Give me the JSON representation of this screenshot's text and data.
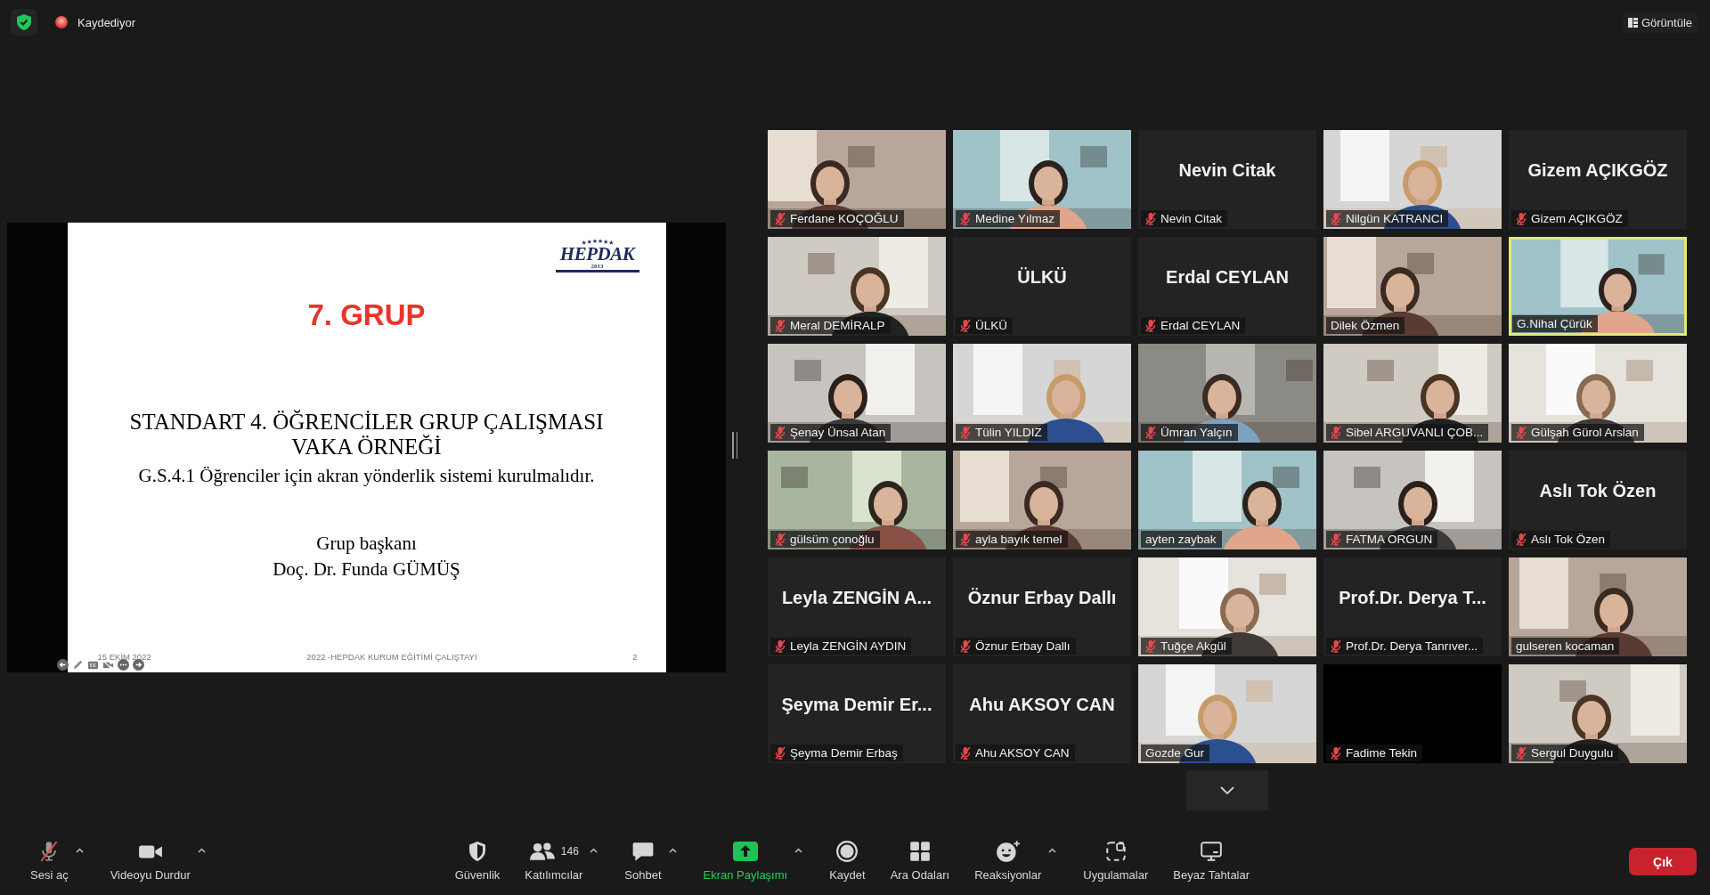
{
  "top_bar": {
    "recording_label": "Kaydediyor",
    "view_button": "Görüntüle"
  },
  "presentation": {
    "logo_text": "HEPDAK",
    "logo_year": "2013",
    "title": "7. GRUP",
    "heading_lines": [
      "STANDART 4. ÖĞRENCİLER GRUP ÇALIŞMASI",
      "VAKA ÖRNEĞİ"
    ],
    "subtitle": "G.S.4.1 Öğrenciler için akran yönderlik sistemi kurulmalıdır.",
    "role": "Grup başkanı",
    "presenter": "Doç. Dr. Funda GÜMÜŞ",
    "footer_date": "15 EKİM 2022",
    "footer_event": "2022 -HEPDAK KURUM EĞİTİMİ ÇALIŞTAYI",
    "page_number": "2"
  },
  "participants": [
    {
      "kind": "video",
      "name": "Ferdane KOÇOĞLU",
      "muted": true,
      "speaking": false
    },
    {
      "kind": "video",
      "name": "Medine Yılmaz",
      "muted": true,
      "speaking": false
    },
    {
      "kind": "name",
      "display_name": "Nevin Citak",
      "name": "Nevin Citak",
      "muted": true,
      "speaking": false
    },
    {
      "kind": "video",
      "name": "Nilgün KATRANCI",
      "muted": true,
      "speaking": false
    },
    {
      "kind": "name",
      "display_name": "Gizem AÇIKGÖZ",
      "name": "Gizem AÇIKGÖZ",
      "muted": true,
      "speaking": false
    },
    {
      "kind": "video",
      "name": "Meral DEMİRALP",
      "muted": true,
      "speaking": false
    },
    {
      "kind": "name",
      "display_name": "ÜLKÜ",
      "name": "ÜLKÜ",
      "muted": true,
      "speaking": false
    },
    {
      "kind": "name",
      "display_name": "Erdal CEYLAN",
      "name": "Erdal CEYLAN",
      "muted": true,
      "speaking": false
    },
    {
      "kind": "video",
      "name": "Dilek Özmen",
      "muted": false,
      "speaking": false
    },
    {
      "kind": "video",
      "name": "G.Nihal Çürük",
      "muted": false,
      "speaking": true
    },
    {
      "kind": "video",
      "name": "Şenay Ünsal Atan",
      "muted": true,
      "speaking": false
    },
    {
      "kind": "video",
      "name": "Tülin YILDIZ",
      "muted": true,
      "speaking": false
    },
    {
      "kind": "video",
      "name": "Ümran Yalçın",
      "muted": true,
      "speaking": false
    },
    {
      "kind": "video",
      "name": "Sibel ARGUVANLI ÇOB...",
      "muted": true,
      "speaking": false
    },
    {
      "kind": "video",
      "name": "Gülşah Gürol Arslan",
      "muted": true,
      "speaking": false
    },
    {
      "kind": "video",
      "name": "gülsüm çonoğlu",
      "muted": true,
      "speaking": false
    },
    {
      "kind": "video",
      "name": "ayla bayık temel",
      "muted": true,
      "speaking": false
    },
    {
      "kind": "video",
      "name": "ayten zaybak",
      "muted": false,
      "speaking": false
    },
    {
      "kind": "video",
      "name": "FATMA ORGUN",
      "muted": true,
      "speaking": false
    },
    {
      "kind": "name",
      "display_name": "Aslı Tok Özen",
      "name": "Aslı Tok Özen",
      "muted": true,
      "speaking": false
    },
    {
      "kind": "name",
      "display_name": "Leyla ZENGİN A...",
      "name": "Leyla ZENGİN AYDIN",
      "muted": true,
      "speaking": false
    },
    {
      "kind": "name",
      "display_name": "Öznur Erbay Dallı",
      "name": "Öznur Erbay Dallı",
      "muted": true,
      "speaking": false
    },
    {
      "kind": "video",
      "name": "Tuğçe Akgül",
      "muted": true,
      "speaking": false
    },
    {
      "kind": "name",
      "display_name": "Prof.Dr. Derya T...",
      "name": "Prof.Dr. Derya Tanrıver...",
      "muted": true,
      "speaking": false
    },
    {
      "kind": "video",
      "name": "gulseren kocaman",
      "muted": false,
      "speaking": false
    },
    {
      "kind": "name",
      "display_name": "Şeyma Demir Er...",
      "name": "Şeyma Demir Erbaş",
      "muted": true,
      "speaking": false
    },
    {
      "kind": "name",
      "display_name": "Ahu AKSOY CAN",
      "name": "Ahu AKSOY CAN",
      "muted": true,
      "speaking": false
    },
    {
      "kind": "video",
      "name": "Gozde Gur",
      "muted": false,
      "speaking": false
    },
    {
      "kind": "off",
      "name": "Fadime Tekin",
      "muted": true,
      "speaking": false
    },
    {
      "kind": "video",
      "name": "Sergul Duygulu",
      "muted": true,
      "speaking": false
    }
  ],
  "toolbar_left": [
    {
      "kind": "mic",
      "label": "Sesi aç",
      "caret": true
    },
    {
      "kind": "video",
      "label": "Videoyu Durdur",
      "caret": true
    }
  ],
  "toolbar_center": [
    {
      "kind": "shield",
      "label": "Güvenlik",
      "caret": false
    },
    {
      "kind": "participants",
      "label": "Katılımcılar",
      "count": "146",
      "caret": true
    },
    {
      "kind": "chat",
      "label": "Sohbet",
      "caret": true
    },
    {
      "kind": "share",
      "label": "Ekran Paylaşımı",
      "caret": true
    },
    {
      "kind": "record",
      "label": "Kaydet",
      "caret": false
    },
    {
      "kind": "breakout",
      "label": "Ara Odaları",
      "caret": false
    },
    {
      "kind": "reactions",
      "label": "Reaksiyonlar",
      "caret": true
    },
    {
      "kind": "apps",
      "label": "Uygulamalar",
      "caret": false
    },
    {
      "kind": "whiteboard",
      "label": "Beyaz Tahtalar",
      "caret": false
    }
  ],
  "leave_button": "Çık"
}
